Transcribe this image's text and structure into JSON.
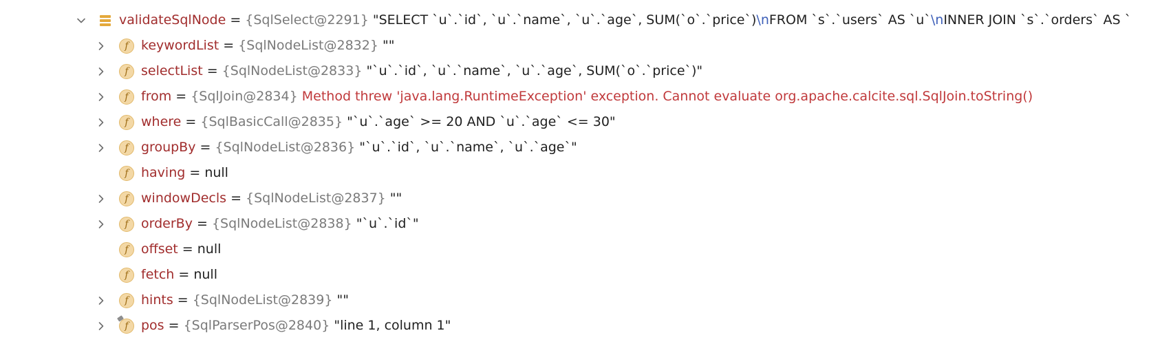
{
  "root": {
    "name": "validateSqlNode",
    "eq": " = ",
    "ref": "{SqlSelect@2291}",
    "value_parts": [
      {
        "t": " \"SELECT `u`.`id`, `u`.`name`, `u`.`age`, SUM(`o`.`price`)",
        "k": "str"
      },
      {
        "t": "\\n",
        "k": "esc"
      },
      {
        "t": "FROM `s`.`users` AS `u`",
        "k": "str"
      },
      {
        "t": "\\n",
        "k": "esc"
      },
      {
        "t": "INNER JOIN `s`.`orders` AS `",
        "k": "str"
      }
    ],
    "expanded": true,
    "icon": "stack-frame-icon"
  },
  "fields": [
    {
      "id": "keywordList",
      "name": "keywordList",
      "ref": "{SqlNodeList@2832}",
      "value": " \"\"",
      "kind": "str",
      "expandable": true,
      "icon": "field-icon"
    },
    {
      "id": "selectList",
      "name": "selectList",
      "ref": "{SqlNodeList@2833}",
      "value": " \"`u`.`id`, `u`.`name`, `u`.`age`, SUM(`o`.`price`)\"",
      "kind": "str",
      "expandable": true,
      "icon": "field-icon"
    },
    {
      "id": "from",
      "name": "from",
      "ref": "{SqlJoin@2834}",
      "value": " Method threw 'java.lang.RuntimeException' exception. Cannot evaluate org.apache.calcite.sql.SqlJoin.toString()",
      "kind": "err",
      "expandable": true,
      "icon": "field-icon"
    },
    {
      "id": "where",
      "name": "where",
      "ref": "{SqlBasicCall@2835}",
      "value": " \"`u`.`age` >= 20 AND `u`.`age` <= 30\"",
      "kind": "str",
      "expandable": true,
      "icon": "field-icon"
    },
    {
      "id": "groupBy",
      "name": "groupBy",
      "ref": "{SqlNodeList@2836}",
      "value": " \"`u`.`id`, `u`.`name`, `u`.`age`\"",
      "kind": "str",
      "expandable": true,
      "icon": "field-icon"
    },
    {
      "id": "having",
      "name": "having",
      "ref": "",
      "value": "null",
      "kind": "null",
      "expandable": false,
      "icon": "field-icon"
    },
    {
      "id": "windowDecls",
      "name": "windowDecls",
      "ref": "{SqlNodeList@2837}",
      "value": " \"\"",
      "kind": "str",
      "expandable": true,
      "icon": "field-icon"
    },
    {
      "id": "orderBy",
      "name": "orderBy",
      "ref": "{SqlNodeList@2838}",
      "value": " \"`u`.`id`\"",
      "kind": "str",
      "expandable": true,
      "icon": "field-icon"
    },
    {
      "id": "offset",
      "name": "offset",
      "ref": "",
      "value": "null",
      "kind": "null",
      "expandable": false,
      "icon": "field-icon"
    },
    {
      "id": "fetch",
      "name": "fetch",
      "ref": "",
      "value": "null",
      "kind": "null",
      "expandable": false,
      "icon": "field-icon"
    },
    {
      "id": "hints",
      "name": "hints",
      "ref": "{SqlNodeList@2839}",
      "value": " \"\"",
      "kind": "str",
      "expandable": true,
      "icon": "field-icon"
    },
    {
      "id": "pos",
      "name": "pos",
      "ref": "{SqlParserPos@2840}",
      "value": " \"line 1, column 1\"",
      "kind": "str",
      "expandable": true,
      "icon": "pinned-field-icon"
    }
  ],
  "field_icon_glyph": "f",
  "eq_text": " = ",
  "colors": {
    "name": "#a12d2d",
    "ref": "#7a7a7a",
    "error": "#c0393b",
    "escape": "#3d5fb8",
    "field_badge": "#f3d8a6",
    "stack_icon": "#e4a93c"
  }
}
